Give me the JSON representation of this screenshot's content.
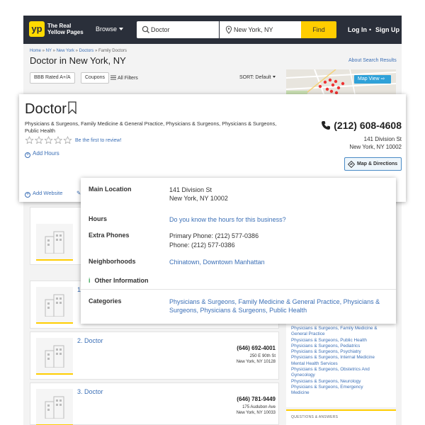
{
  "header": {
    "logo_badge": "yp",
    "logo_text": "The Real\nYellow Pages",
    "browse_label": "Browse",
    "search_value": "Doctor",
    "location_value": "New York, NY",
    "find_label": "Find",
    "login_label": "Log In",
    "separator": "•",
    "signup_label": "Sign Up"
  },
  "breadcrumb": {
    "items": [
      "Home",
      "NY",
      "New York",
      "Doctors",
      "Family Doctors"
    ],
    "separator": " » "
  },
  "page_title": "Doctor in New York, NY",
  "about_search": "About Search Results",
  "filters": {
    "chips": [
      "BBB Rated A+/A",
      "Coupons"
    ],
    "all_filters": "All Filters",
    "sort": "SORT: Default"
  },
  "map": {
    "button_label": "Map View"
  },
  "detail": {
    "name": "Doctor",
    "categories": "Physicians & Surgeons, Family Medicine & General Practice, Physicians & Surgeons, Physicians & Surgeons, Public Health",
    "review_prompt": "Be the first to review!",
    "add_hours": "Add Hours",
    "add_website": "Add Website",
    "add_s_partial": "S",
    "phone": "(212) 608-4608",
    "address": "141 Division St\nNew York, NY 10002",
    "directions_label": "Map & Directions"
  },
  "popover": {
    "main_location_label": "Main Location",
    "main_location_value": "141 Division St\nNew York, NY 10002",
    "hours_label": "Hours",
    "hours_value": "Do you know the hours for this business?",
    "extra_phones_label": "Extra Phones",
    "primary_phone": "Primary Phone: (212) 577-0386",
    "phone": "Phone: (212) 577-0386",
    "neighborhoods_label": "Neighborhoods",
    "neighborhoods_value": "Chinatown, Downtown Manhattan",
    "other_info_label": "Other Information",
    "categories_label": "Categories",
    "categories_value": "Physicians & Surgeons, Family Medicine & General Practice, Physicians & Surgeons, Physicians & Surgeons, Public Health"
  },
  "results": [
    {
      "name": "1",
      "phone": "",
      "address": ""
    },
    {
      "name": "2. Doctor",
      "phone": "(646) 692-4001",
      "address": "250 E 90th St\nNew York, NY 10128"
    },
    {
      "name": "3. Doctor",
      "phone": "(646) 781-9449",
      "address": "175 Audubon Ave\nNew York, NY 10033"
    }
  ],
  "sidebar_categories": [
    "Physicians & Surgeons, Family Medicine &",
    "General Practice",
    "Physicians & Surgeons, Public Health",
    "Physicians & Surgeons, Pediatrics",
    "Physicians & Surgeons, Psychiatry",
    "Physicians & Surgeons, Internal Medicine",
    "Mental Health Services",
    "Physicians & Surgeons, Obstetrics And",
    "Gynecology",
    "Physicians & Surgeons, Neurology",
    "Physicians & Surgeons, Emergency",
    "Medicine"
  ],
  "qa_label": "QUESTIONS & ANSWERS",
  "colors": {
    "brand_yellow": "#ffda00",
    "nav_bg": "#2a2f3a",
    "link_blue": "#3b6fb6",
    "map_button": "#2fa1d8"
  }
}
